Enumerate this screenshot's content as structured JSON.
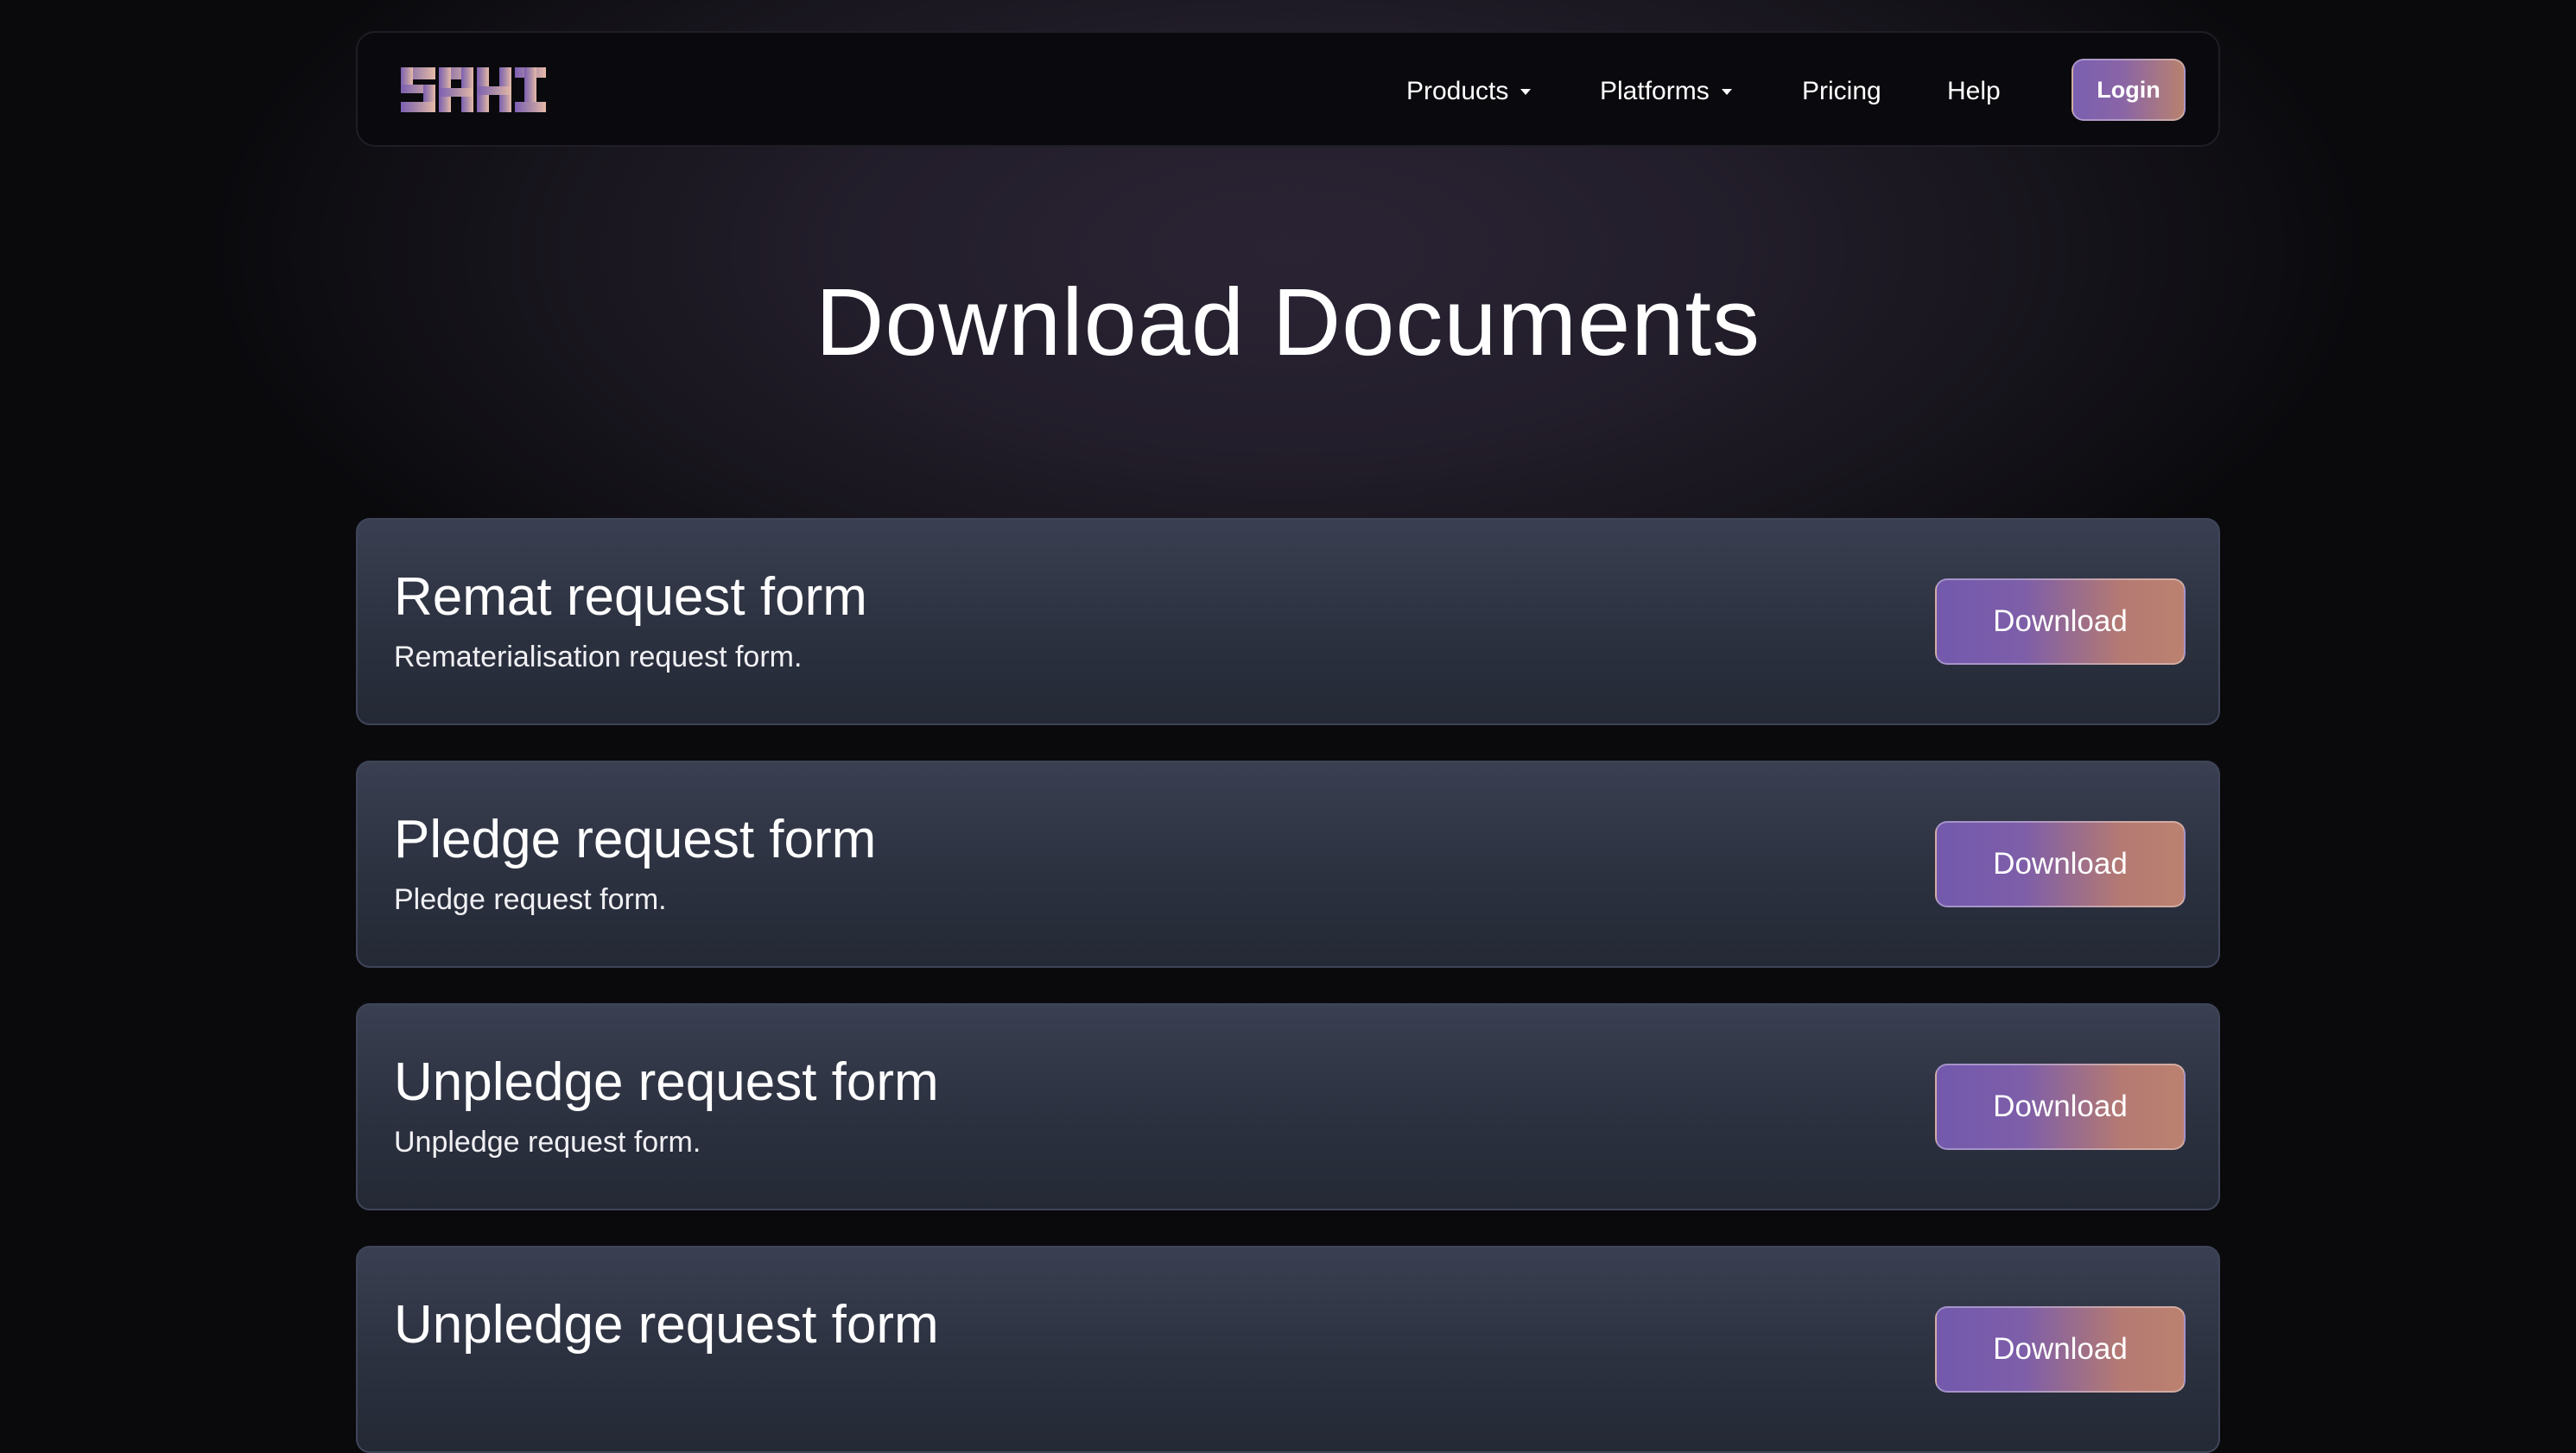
{
  "brand": {
    "logo_text": "SAHI"
  },
  "nav": {
    "items": [
      {
        "label": "Products",
        "has_dropdown": true
      },
      {
        "label": "Platforms",
        "has_dropdown": true
      },
      {
        "label": "Pricing",
        "has_dropdown": false
      },
      {
        "label": "Help",
        "has_dropdown": false
      }
    ],
    "login_label": "Login"
  },
  "page": {
    "title": "Download Documents"
  },
  "documents": [
    {
      "title": "Remat request form",
      "description": "Rematerialisation request form.",
      "button_label": "Download"
    },
    {
      "title": "Pledge request form",
      "description": "Pledge request form.",
      "button_label": "Download"
    },
    {
      "title": "Unpledge request form",
      "description": "Unpledge request form.",
      "button_label": "Download"
    },
    {
      "title": "Unpledge request form",
      "description": "",
      "button_label": "Download"
    }
  ],
  "colors": {
    "background": "#0a0a0d",
    "card": "#323747",
    "button_gradient_start": "#7359ad",
    "button_gradient_end": "#bb8170"
  }
}
